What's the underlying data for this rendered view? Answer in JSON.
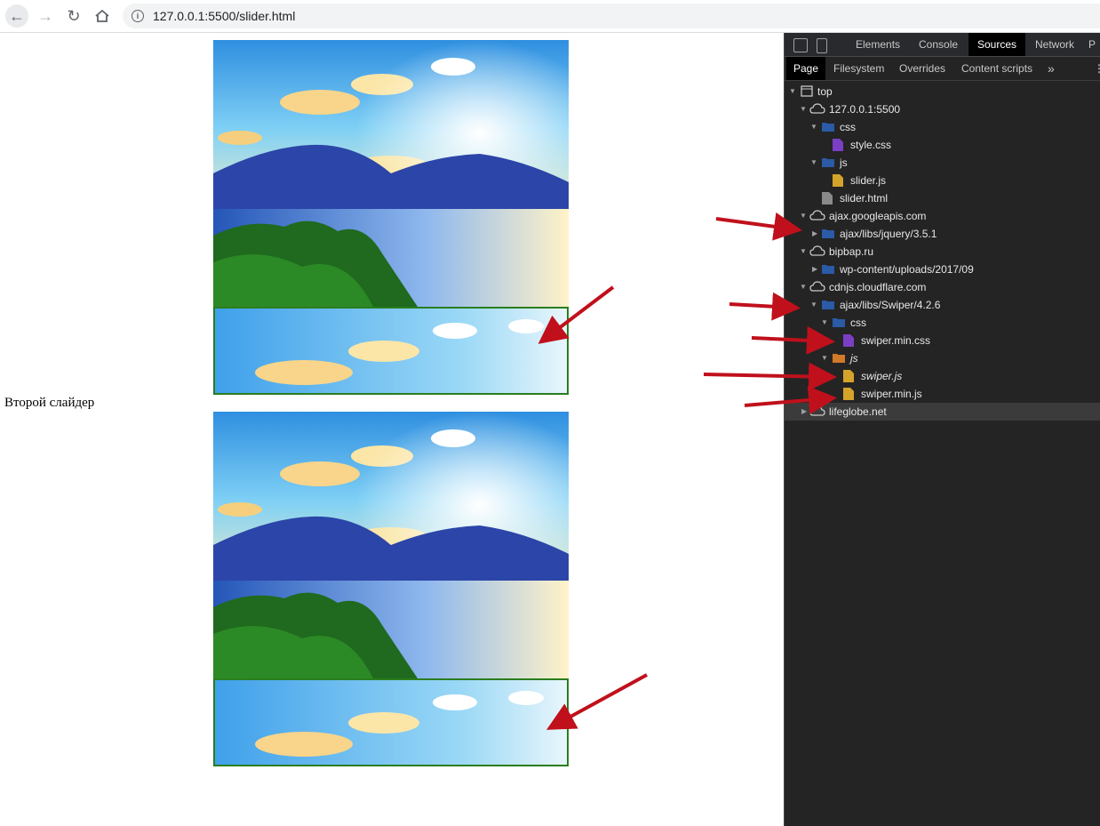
{
  "browser": {
    "url": "127.0.0.1:5500/slider.html"
  },
  "page": {
    "second_slider_label": "Второй слайдер"
  },
  "devtools": {
    "tabs": [
      "Elements",
      "Console",
      "Sources",
      "Network",
      "P"
    ],
    "active_tab": "Sources",
    "subtabs": [
      "Page",
      "Filesystem",
      "Overrides",
      "Content scripts"
    ],
    "more_tabs": "»",
    "tree": [
      {
        "label": "top",
        "type": "frame"
      },
      {
        "label": "127.0.0.1:5500",
        "type": "domain"
      },
      {
        "label": "css",
        "type": "folder"
      },
      {
        "label": "style.css",
        "type": "css-file"
      },
      {
        "label": "js",
        "type": "folder"
      },
      {
        "label": "slider.js",
        "type": "js-file"
      },
      {
        "label": "slider.html",
        "type": "html-file"
      },
      {
        "label": "ajax.googleapis.com",
        "type": "domain"
      },
      {
        "label": "ajax/libs/jquery/3.5.1",
        "type": "folder"
      },
      {
        "label": "bipbap.ru",
        "type": "domain"
      },
      {
        "label": "wp-content/uploads/2017/09",
        "type": "folder"
      },
      {
        "label": "cdnjs.cloudflare.com",
        "type": "domain"
      },
      {
        "label": "ajax/libs/Swiper/4.2.6",
        "type": "folder"
      },
      {
        "label": "css",
        "type": "folder"
      },
      {
        "label": "swiper.min.css",
        "type": "css-file"
      },
      {
        "label": "js",
        "type": "folder-orange"
      },
      {
        "label": "swiper.js",
        "type": "js-file"
      },
      {
        "label": "swiper.min.js",
        "type": "js-file"
      },
      {
        "label": "lifeglobe.net",
        "type": "domain"
      }
    ]
  },
  "colors": {
    "arrow": "#c0101c",
    "thumb_border": "#2a7d1e",
    "folder_blue": "#2b5aa6",
    "css_purple": "#7b3fc4",
    "js_yellow": "#d4a32a"
  }
}
